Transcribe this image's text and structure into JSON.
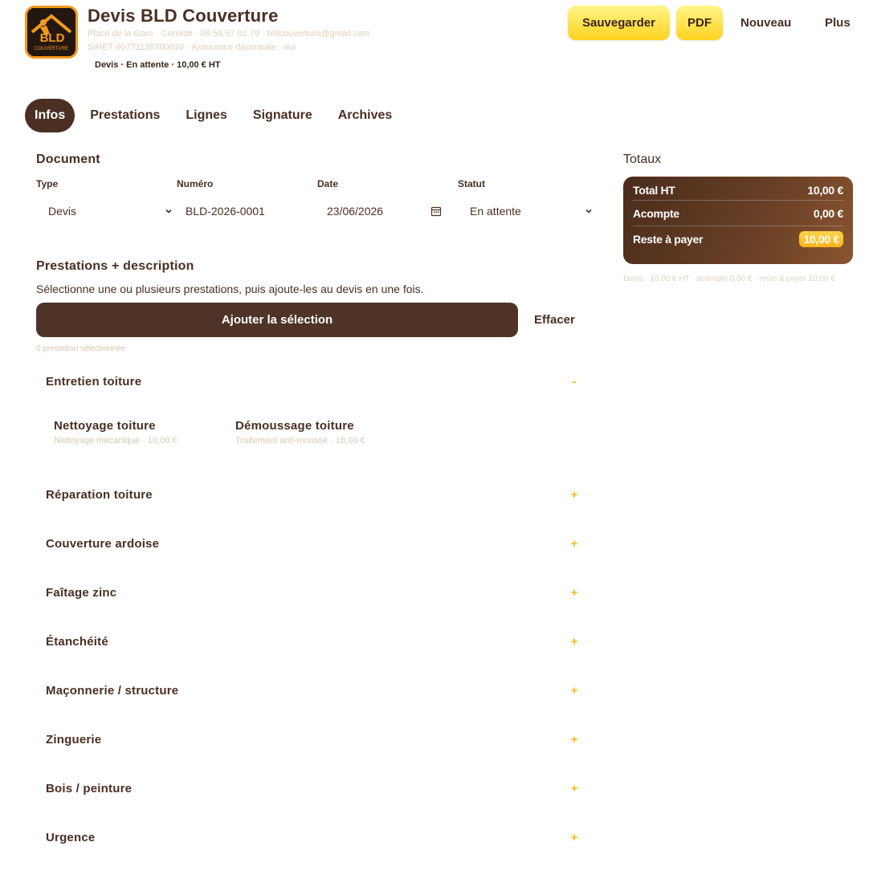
{
  "header": {
    "title": "Devis BLD Couverture",
    "meta_line1": "Place de la Gare · Correze · 06.59.67.01.79 · bldcouverture@gmail.com",
    "meta_line2": "SIRET 90771138700010 · Assurance décennale : oui",
    "subtitle": "Devis · En attente · 10,00 € HT",
    "logo_text": "BLD",
    "logo_subtext": "COUVERTURE",
    "buttons": {
      "save": "Sauvegarder",
      "pdf": "PDF",
      "new": "Nouveau",
      "more": "Plus"
    }
  },
  "tabs": [
    {
      "label": "Infos",
      "active": true
    },
    {
      "label": "Prestations",
      "active": false
    },
    {
      "label": "Lignes",
      "active": false
    },
    {
      "label": "Signature",
      "active": false
    },
    {
      "label": "Archives",
      "active": false
    }
  ],
  "document": {
    "title": "Document",
    "labels": {
      "type": "Type",
      "number": "Numéro",
      "date": "Date",
      "status": "Statut"
    },
    "values": {
      "type": "Devis",
      "number": "BLD-2026-0001",
      "date": "23/06/2026",
      "status": "En attente"
    }
  },
  "prestations": {
    "title": "Prestations + description",
    "description": "Sélectionne une ou plusieurs prestations, puis ajoute-les au devis en une fois.",
    "add_button": "Ajouter la sélection",
    "clear_button": "Effacer",
    "selected_count": "0 prestation sélectionnée",
    "categories": [
      {
        "name": "Entretien toiture",
        "toggle": "-",
        "expanded": true
      },
      {
        "name": "Réparation toiture",
        "toggle": "+"
      },
      {
        "name": "Couverture ardoise",
        "toggle": "+"
      },
      {
        "name": "Faîtage zinc",
        "toggle": "+"
      },
      {
        "name": "Étanchéité",
        "toggle": "+"
      },
      {
        "name": "Maçonnerie / structure",
        "toggle": "+"
      },
      {
        "name": "Zinguerie",
        "toggle": "+"
      },
      {
        "name": "Bois / peinture",
        "toggle": "+"
      },
      {
        "name": "Urgence",
        "toggle": "+"
      }
    ],
    "items": [
      {
        "name": "Nettoyage toiture",
        "detail": "Nettoyage mécanique · 10,00 €"
      },
      {
        "name": "Démoussage toiture",
        "detail": "Traitement anti-mousse · 18,00 €"
      }
    ]
  },
  "totals": {
    "title": "Totaux",
    "rows": [
      {
        "label": "Total HT",
        "value": "10,00 €"
      },
      {
        "label": "Acompte",
        "value": "0,00 €"
      },
      {
        "label": "Reste à payer",
        "value": "10,00 €"
      }
    ],
    "note": "Devis : 10,00 € HT · acompte 0,00 € · reste à payer 10,00 €"
  },
  "colors": {
    "brand_brown": "#4a2f22",
    "accent_yellow": "#ffd21e",
    "accent_orange": "#f39a1c"
  }
}
